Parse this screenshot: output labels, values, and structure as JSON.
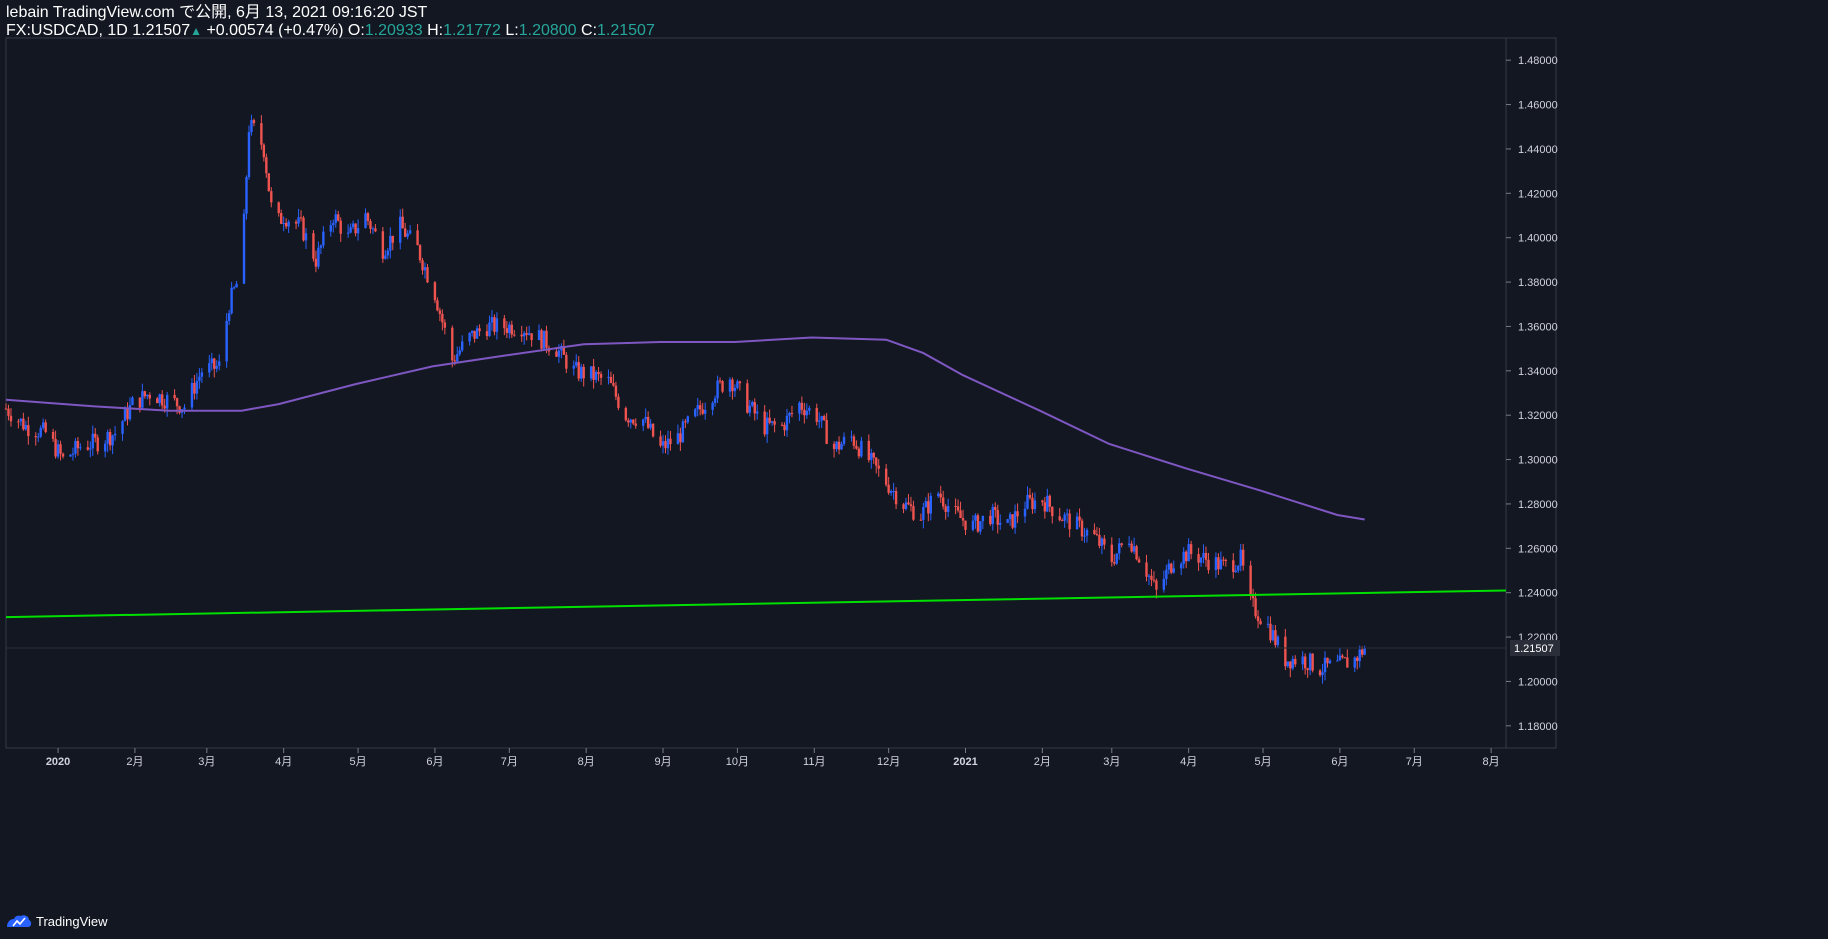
{
  "header": {
    "line1": "lebain TradingView.com で公開, 6月 13, 2021 09:16:20 JST",
    "symbol": "FX:USDCAD, 1D",
    "last": "1.21507",
    "arrow": "▲",
    "change": "+0.00574 (+0.47%)",
    "o_label": "O:",
    "o_value": "1.20933",
    "h_label": "H:",
    "h_value": "1.21772",
    "l_label": "L:",
    "l_value": "1.20800",
    "c_label": "C:",
    "c_value": "1.21507"
  },
  "footer": {
    "brand": "TradingView",
    "logo_icon": "tradingview-logo-icon"
  },
  "colors": {
    "background": "#131722",
    "up": "#2962ff",
    "down": "#ef5350",
    "ma": "#7e57c2",
    "trendline": "#00e000",
    "axis_text": "#d1d4dc",
    "border": "#363a45"
  },
  "chart_data": {
    "type": "candlestick",
    "title": "",
    "ylim": [
      1.17,
      1.49
    ],
    "y_ticks": [
      "1.18000",
      "1.20000",
      "1.22000",
      "1.24000",
      "1.26000",
      "1.28000",
      "1.30000",
      "1.32000",
      "1.34000",
      "1.36000",
      "1.38000",
      "1.40000",
      "1.42000",
      "1.44000",
      "1.46000",
      "1.48000"
    ],
    "x_ticks": [
      {
        "label": "2020",
        "date": "2020-01-01"
      },
      {
        "label": "2月",
        "date": "2020-02-01"
      },
      {
        "label": "3月",
        "date": "2020-03-01"
      },
      {
        "label": "4月",
        "date": "2020-04-01"
      },
      {
        "label": "5月",
        "date": "2020-05-01"
      },
      {
        "label": "6月",
        "date": "2020-06-01"
      },
      {
        "label": "7月",
        "date": "2020-07-01"
      },
      {
        "label": "8月",
        "date": "2020-08-01"
      },
      {
        "label": "9月",
        "date": "2020-09-01"
      },
      {
        "label": "10月",
        "date": "2020-10-01"
      },
      {
        "label": "11月",
        "date": "2020-11-01"
      },
      {
        "label": "12月",
        "date": "2020-12-01"
      },
      {
        "label": "2021",
        "date": "2021-01-01"
      },
      {
        "label": "2月",
        "date": "2021-02-01"
      },
      {
        "label": "3月",
        "date": "2021-03-01"
      },
      {
        "label": "4月",
        "date": "2021-04-01"
      },
      {
        "label": "5月",
        "date": "2021-05-01"
      },
      {
        "label": "6月",
        "date": "2021-06-01"
      },
      {
        "label": "7月",
        "date": "2021-07-01"
      },
      {
        "label": "8月",
        "date": "2021-08-01"
      }
    ],
    "xlim": [
      "2019-12-11",
      "2021-08-07"
    ],
    "last_price_label": "1.21507",
    "last_price": 1.21507,
    "close_path": [
      [
        "2019-12-11",
        1.323
      ],
      [
        "2019-12-19",
        1.315
      ],
      [
        "2019-12-27",
        1.312
      ],
      [
        "2020-01-03",
        1.3
      ],
      [
        "2020-01-10",
        1.306
      ],
      [
        "2020-01-17",
        1.308
      ],
      [
        "2020-01-24",
        1.312
      ],
      [
        "2020-01-31",
        1.325
      ],
      [
        "2020-02-07",
        1.33
      ],
      [
        "2020-02-14",
        1.327
      ],
      [
        "2020-02-21",
        1.324
      ],
      [
        "2020-02-28",
        1.34
      ],
      [
        "2020-03-06",
        1.342
      ],
      [
        "2020-03-10",
        1.37
      ],
      [
        "2020-03-15",
        1.385
      ],
      [
        "2020-03-18",
        1.45
      ],
      [
        "2020-03-21",
        1.448
      ],
      [
        "2020-03-24",
        1.44
      ],
      [
        "2020-03-28",
        1.405
      ],
      [
        "2020-04-01",
        1.41
      ],
      [
        "2020-04-08",
        1.405
      ],
      [
        "2020-04-14",
        1.39
      ],
      [
        "2020-04-21",
        1.41
      ],
      [
        "2020-04-27",
        1.4
      ],
      [
        "2020-05-04",
        1.41
      ],
      [
        "2020-05-11",
        1.395
      ],
      [
        "2020-05-18",
        1.405
      ],
      [
        "2020-05-25",
        1.395
      ],
      [
        "2020-06-01",
        1.375
      ],
      [
        "2020-06-08",
        1.345
      ],
      [
        "2020-06-15",
        1.355
      ],
      [
        "2020-06-22",
        1.36
      ],
      [
        "2020-06-30",
        1.36
      ],
      [
        "2020-07-06",
        1.36
      ],
      [
        "2020-07-13",
        1.355
      ],
      [
        "2020-07-20",
        1.35
      ],
      [
        "2020-07-27",
        1.34
      ],
      [
        "2020-08-03",
        1.338
      ],
      [
        "2020-08-10",
        1.335
      ],
      [
        "2020-08-17",
        1.32
      ],
      [
        "2020-08-24",
        1.318
      ],
      [
        "2020-08-31",
        1.305
      ],
      [
        "2020-09-07",
        1.31
      ],
      [
        "2020-09-14",
        1.32
      ],
      [
        "2020-09-21",
        1.33
      ],
      [
        "2020-09-28",
        1.337
      ],
      [
        "2020-10-05",
        1.325
      ],
      [
        "2020-10-12",
        1.315
      ],
      [
        "2020-10-19",
        1.315
      ],
      [
        "2020-10-26",
        1.325
      ],
      [
        "2020-11-02",
        1.32
      ],
      [
        "2020-11-09",
        1.305
      ],
      [
        "2020-11-16",
        1.31
      ],
      [
        "2020-11-23",
        1.3
      ],
      [
        "2020-11-30",
        1.29
      ],
      [
        "2020-12-07",
        1.28
      ],
      [
        "2020-12-14",
        1.275
      ],
      [
        "2020-12-21",
        1.285
      ],
      [
        "2020-12-28",
        1.275
      ],
      [
        "2021-01-04",
        1.27
      ],
      [
        "2021-01-11",
        1.275
      ],
      [
        "2021-01-18",
        1.27
      ],
      [
        "2021-01-25",
        1.28
      ],
      [
        "2021-02-01",
        1.282
      ],
      [
        "2021-02-08",
        1.275
      ],
      [
        "2021-02-15",
        1.27
      ],
      [
        "2021-02-22",
        1.265
      ],
      [
        "2021-03-01",
        1.255
      ],
      [
        "2021-03-08",
        1.265
      ],
      [
        "2021-03-15",
        1.25
      ],
      [
        "2021-03-19",
        1.24
      ],
      [
        "2021-03-26",
        1.255
      ],
      [
        "2021-04-01",
        1.258
      ],
      [
        "2021-04-08",
        1.255
      ],
      [
        "2021-04-15",
        1.252
      ],
      [
        "2021-04-22",
        1.255
      ],
      [
        "2021-04-26",
        1.235
      ],
      [
        "2021-05-03",
        1.225
      ],
      [
        "2021-05-10",
        1.21
      ],
      [
        "2021-05-17",
        1.21
      ],
      [
        "2021-05-24",
        1.206
      ],
      [
        "2021-05-31",
        1.207
      ],
      [
        "2021-06-07",
        1.21
      ],
      [
        "2021-06-11",
        1.21507
      ]
    ],
    "series": [
      {
        "type": "line",
        "points": [
          [
            "2019-12-11",
            1.327
          ],
          [
            "2020-01-15",
            1.324
          ],
          [
            "2020-02-15",
            1.322
          ],
          [
            "2020-03-15",
            1.322
          ],
          [
            "2020-03-30",
            1.325
          ],
          [
            "2020-04-30",
            1.334
          ],
          [
            "2020-05-31",
            1.342
          ],
          [
            "2020-06-30",
            1.347
          ],
          [
            "2020-07-31",
            1.352
          ],
          [
            "2020-08-31",
            1.353
          ],
          [
            "2020-09-30",
            1.353
          ],
          [
            "2020-10-31",
            1.355
          ],
          [
            "2020-11-30",
            1.354
          ],
          [
            "2020-12-15",
            1.348
          ],
          [
            "2020-12-31",
            1.338
          ],
          [
            "2021-01-31",
            1.322
          ],
          [
            "2021-02-28",
            1.307
          ],
          [
            "2021-03-31",
            1.296
          ],
          [
            "2021-04-30",
            1.286
          ],
          [
            "2021-05-31",
            1.275
          ],
          [
            "2021-06-11",
            1.273
          ]
        ]
      },
      {
        "type": "trendline",
        "points": [
          [
            "2019-12-11",
            1.229
          ],
          [
            "2021-08-07",
            1.241
          ]
        ]
      }
    ]
  }
}
